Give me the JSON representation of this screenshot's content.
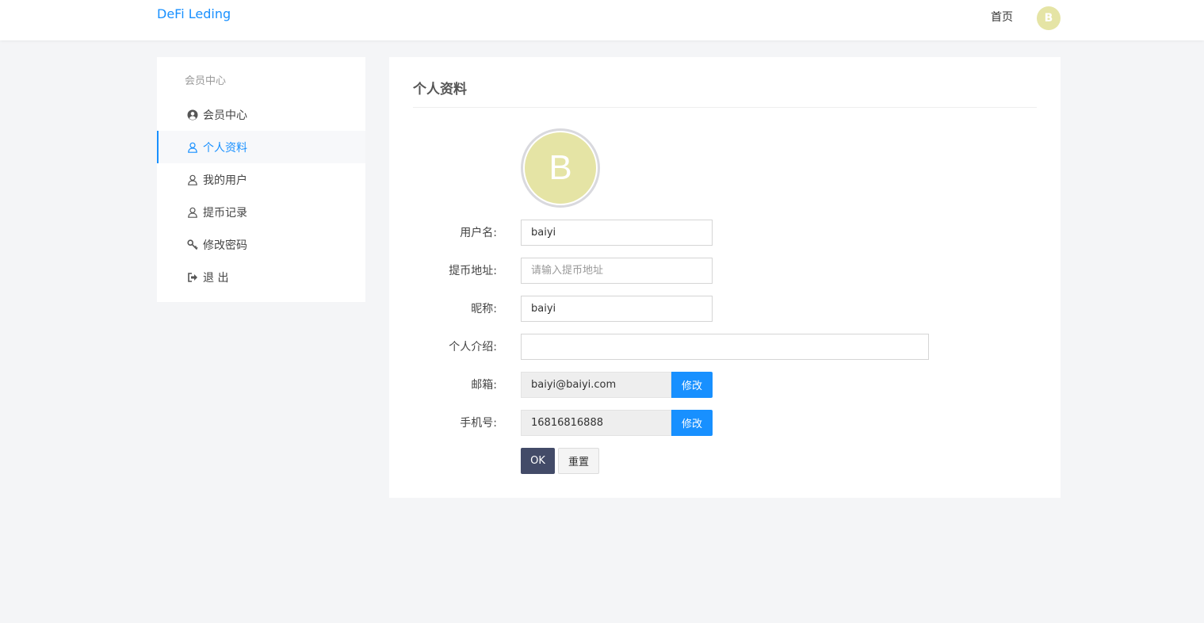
{
  "header": {
    "brand": "DeFi Leding",
    "home_link": "首页",
    "avatar_letter": "B",
    "avatar_color": "#e5e4a5",
    "accent_color": "#1890ff"
  },
  "sidebar": {
    "title": "会员中心",
    "items": [
      {
        "label": "会员中心",
        "icon": "user-circle-icon",
        "active": false
      },
      {
        "label": "个人资料",
        "icon": "user-icon",
        "active": true
      },
      {
        "label": "我的用户",
        "icon": "user-icon",
        "active": false
      },
      {
        "label": "提币记录",
        "icon": "user-icon",
        "active": false
      },
      {
        "label": "修改密码",
        "icon": "key-icon",
        "active": false
      },
      {
        "label": "退 出",
        "icon": "sign-out-icon",
        "active": false
      }
    ]
  },
  "profile": {
    "title": "个人资料",
    "avatar_letter": "B",
    "fields": {
      "username": {
        "label": "用户名:",
        "value": "baiyi"
      },
      "withdraw_address": {
        "label": "提币地址:",
        "value": "",
        "placeholder": "请输入提币地址"
      },
      "nickname": {
        "label": "昵称:",
        "value": "baiyi"
      },
      "bio": {
        "label": "个人介绍:",
        "value": ""
      },
      "email": {
        "label": "邮箱:",
        "value": "baiyi@baiyi.com",
        "action": "修改"
      },
      "phone": {
        "label": "手机号:",
        "value": "16816816888",
        "action": "修改"
      }
    },
    "ok_label": "OK",
    "reset_label": "重置"
  }
}
